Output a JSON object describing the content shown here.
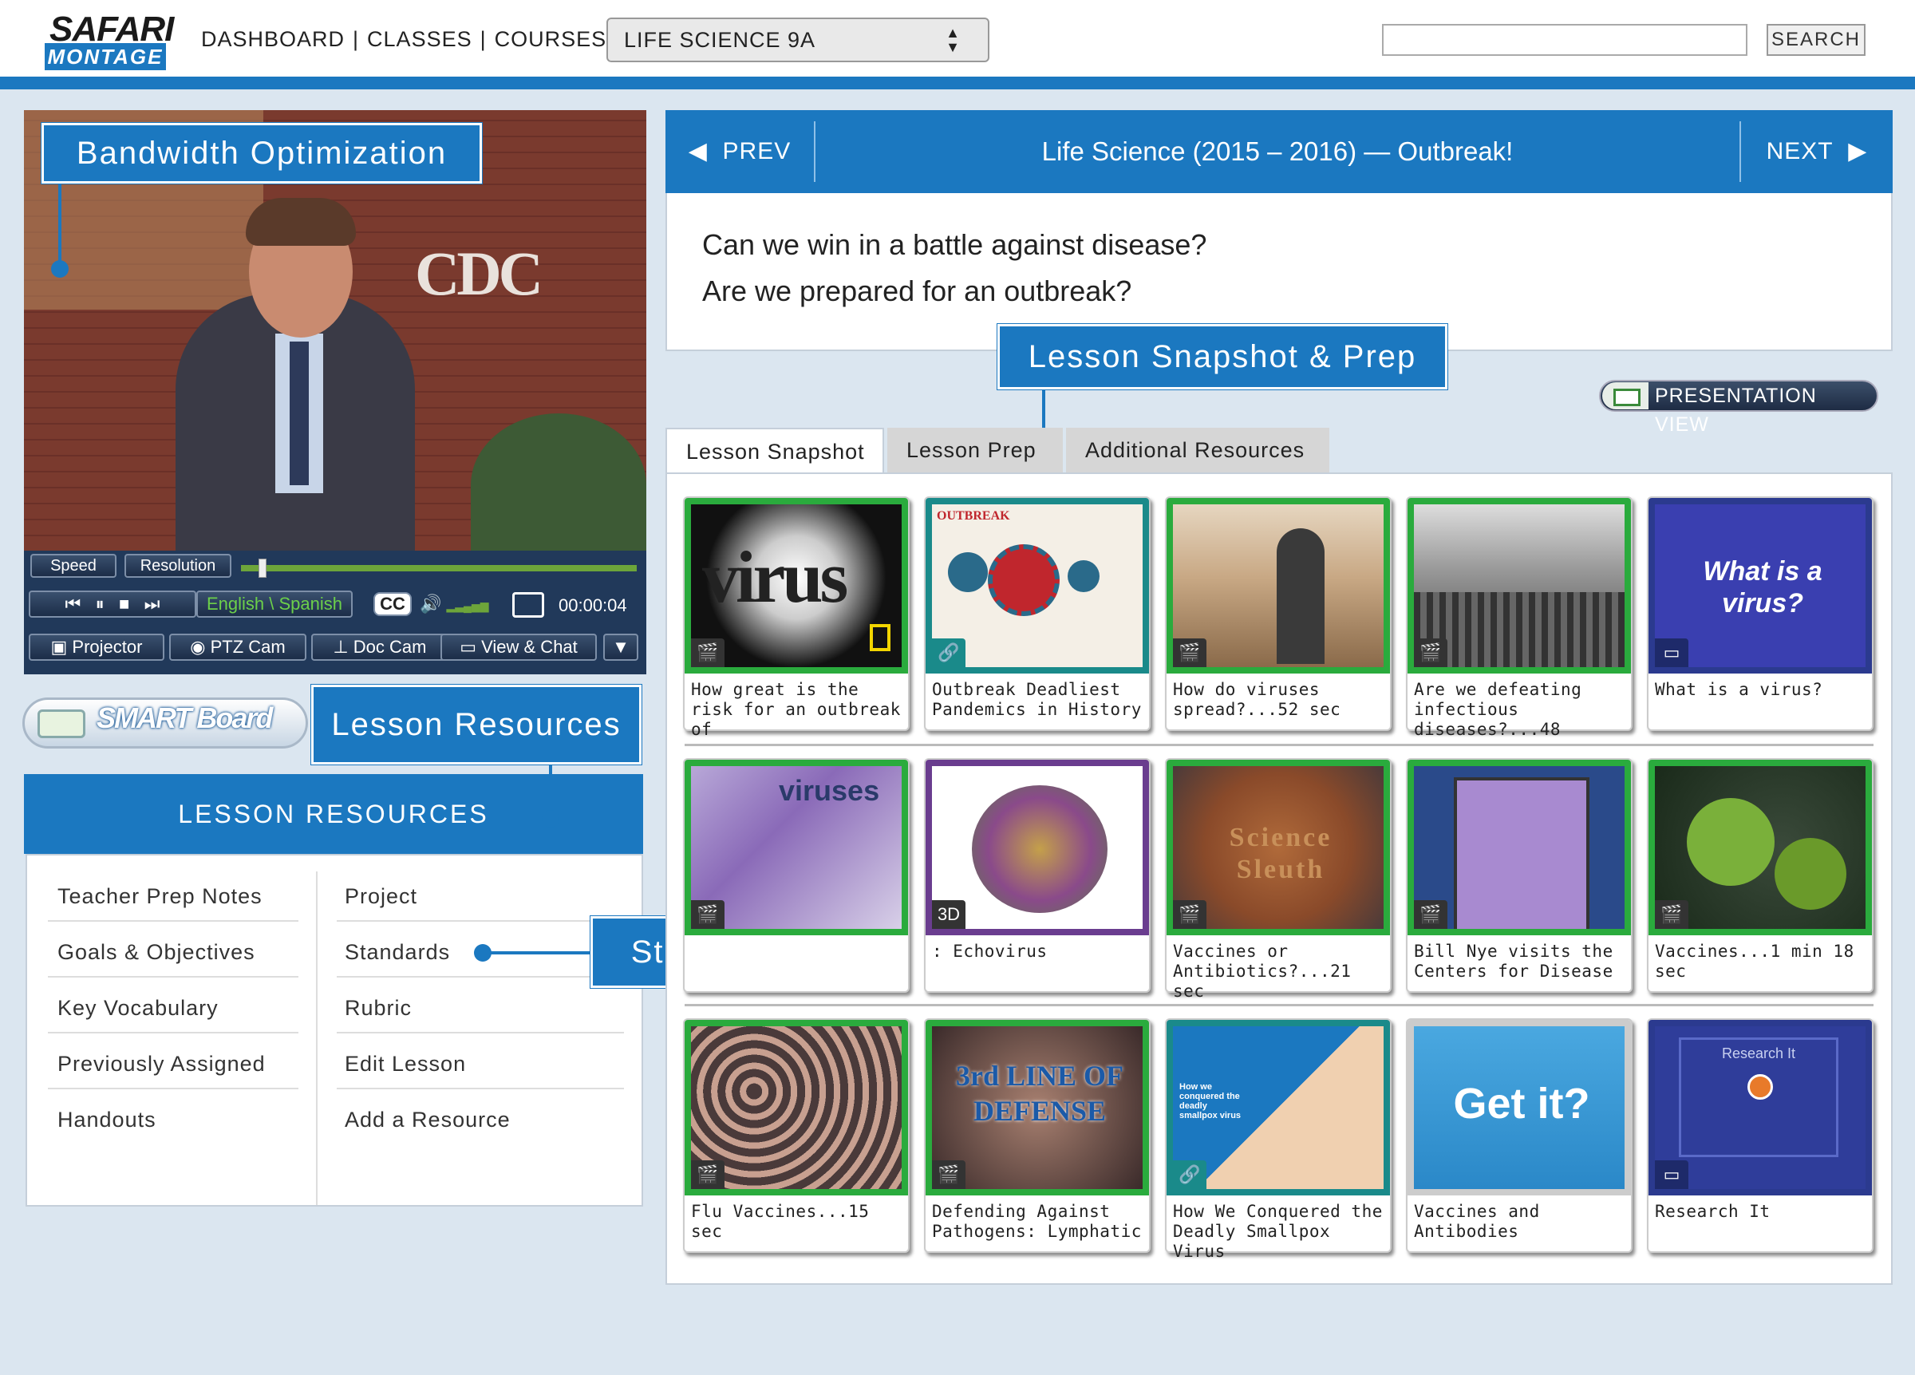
{
  "header": {
    "logo_top": "SAFARI",
    "logo_bottom": "MONTAGE",
    "nav": [
      "DASHBOARD",
      "CLASSES",
      "COURSES"
    ],
    "class_select": "LIFE SCIENCE 9A",
    "search_button": "SEARCH",
    "search_value": ""
  },
  "callouts": {
    "bandwidth": "Bandwidth Optimization",
    "lesson_resources": "Lesson Resources",
    "lesson_snapshot_prep": "Lesson Snapshot & Prep",
    "standards": "Standards Integration"
  },
  "video": {
    "sign_text": "CDC",
    "speed": "Speed",
    "resolution": "Resolution",
    "language": "English \\ Spanish",
    "cc": "CC",
    "time": "00:00:04",
    "projector": "Projector",
    "ptz_cam": "PTZ Cam",
    "doc_cam": "Doc Cam",
    "view_chat": "View & Chat",
    "progress": 0.04
  },
  "smartboard": {
    "label": "SMART Board"
  },
  "resources": {
    "title": "LESSON RESOURCES",
    "left": [
      "Teacher Prep Notes",
      "Goals & Objectives",
      "Key Vocabulary",
      "Previously Assigned",
      "Handouts"
    ],
    "right": [
      "Project",
      "Standards",
      "Rubric",
      "Edit Lesson",
      "Add a Resource"
    ]
  },
  "lesson": {
    "prev": "PREV",
    "next": "NEXT",
    "title": "Life Science (2015 – 2016) — Outbreak!",
    "q1": "Can we win in a battle against disease?",
    "q2": "Are we prepared for an outbreak?",
    "presentation_view": "PRESENTATION VIEW",
    "tabs": [
      "Lesson Snapshot",
      "Lesson Prep",
      "Additional Resources"
    ]
  },
  "tiles": [
    {
      "caption": "How great is the risk for an outbreak of",
      "thumb_text": "virus",
      "type": "video",
      "border": "#2aab3d"
    },
    {
      "caption": "Outbreak Deadliest Pandemics in History",
      "thumb_text": "OUTBREAK",
      "type": "link",
      "border": "#1a8a8a"
    },
    {
      "caption": "How do viruses spread?...52 sec",
      "thumb_text": "",
      "type": "video",
      "border": "#2aab3d"
    },
    {
      "caption": "Are we defeating infectious diseases?...48",
      "thumb_text": "",
      "type": "video",
      "border": "#2aab3d"
    },
    {
      "caption": "What is a virus?",
      "thumb_text": "What is a virus?",
      "type": "interactive",
      "border": "#2b3a8f"
    },
    {
      "caption": "",
      "thumb_text": "viruses",
      "type": "video",
      "border": "#2aab3d"
    },
    {
      "caption": ": Echovirus",
      "thumb_text": "3D",
      "type": "3d",
      "border": "#6a3d8f"
    },
    {
      "caption": "Vaccines or Antibiotics?...21 sec",
      "thumb_text": "Science Sleuth",
      "type": "video",
      "border": "#2aab3d"
    },
    {
      "caption": "Bill Nye visits the Centers for Disease",
      "thumb_text": "",
      "type": "video",
      "border": "#2aab3d"
    },
    {
      "caption": "Vaccines...1 min 18 sec",
      "thumb_text": "",
      "type": "video",
      "border": "#2aab3d"
    },
    {
      "caption": "Flu Vaccines...15 sec",
      "thumb_text": "",
      "type": "video",
      "border": "#2aab3d"
    },
    {
      "caption": "Defending Against Pathogens: Lymphatic",
      "thumb_text": "3rd LINE OF DEFENSE",
      "type": "video",
      "border": "#2aab3d"
    },
    {
      "caption": "How We Conquered the Deadly Smallpox Virus",
      "thumb_text": "How we conquered the deadly smallpox virus",
      "type": "link",
      "border": "#1a8a8a"
    },
    {
      "caption": "Vaccines and Antibodies",
      "thumb_text": "Get it?",
      "type": "quiz",
      "border": "#cccccc"
    },
    {
      "caption": "Research It",
      "thumb_text": "Research It",
      "type": "interactive",
      "border": "#2b3a8f"
    }
  ]
}
